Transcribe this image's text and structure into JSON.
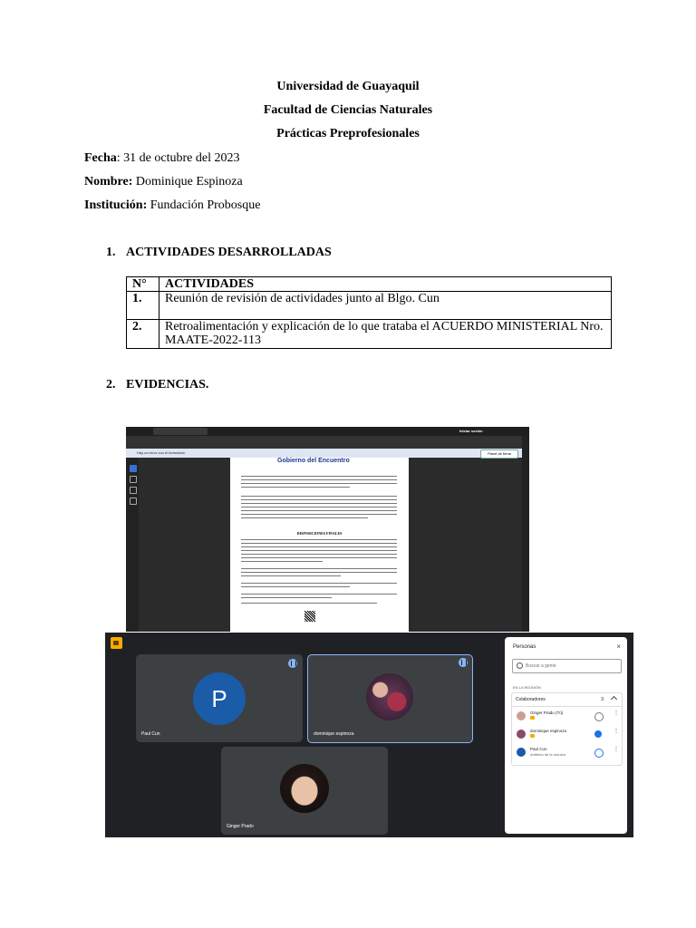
{
  "header": {
    "university": "Universidad de Guayaquil",
    "faculty": "Facultad de Ciencias Naturales",
    "program": "Prácticas Preprofesionales"
  },
  "fields": {
    "date_label": "Fecha",
    "date_value": ": 31 de octubre del 2023",
    "name_label": "Nombre:",
    "name_value": " Dominique Espinoza",
    "institution_label": "Institución:",
    "institution_value": " Fundación Probosque"
  },
  "sections": [
    {
      "number": "1.",
      "title": "ACTIVIDADES DESARROLLADAS"
    },
    {
      "number": "2.",
      "title": "EVIDENCIAS."
    }
  ],
  "activities_table": {
    "headers": [
      "N°",
      "ACTIVIDADES"
    ],
    "rows": [
      {
        "n": "1.",
        "text": "Reunión de revisión de actividades junto al Blgo. Cun"
      },
      {
        "n": "2.",
        "text": "Retroalimentación y explicación de lo que trataba el ACUERDO MINISTERIAL Nro. MAATE-2022-113"
      }
    ]
  },
  "screenshot_doc": {
    "notice": "Hay un error con el formulario",
    "panel_button": "Panel de firma",
    "signin": "Iniciar sesión",
    "logo": "Gobierno del Encuentro",
    "heading": "DISPOSICIONES FINALES"
  },
  "screenshot_meet": {
    "tiles": [
      {
        "name": "Paul Cun",
        "initial": "P"
      },
      {
        "name": "dominique espinoza"
      },
      {
        "name": "Ginger Prado"
      }
    ],
    "panel": {
      "title": "Personas",
      "search_placeholder": "Buscar a gente",
      "section_label": "EN LA REUNIÓN",
      "group_label": "Colaboradores",
      "group_count": "3",
      "people": [
        {
          "name": "Ginger Prado (Tú)",
          "sub": ""
        },
        {
          "name": "dominique espinoza",
          "sub": ""
        },
        {
          "name": "Paul Cun",
          "sub": "Anfitrión de la reunión"
        }
      ]
    },
    "colors": {
      "avatar_blue": "#1a5ca8",
      "accent": "#8ab4f8",
      "meet_yellow": "#f9ab00"
    }
  }
}
